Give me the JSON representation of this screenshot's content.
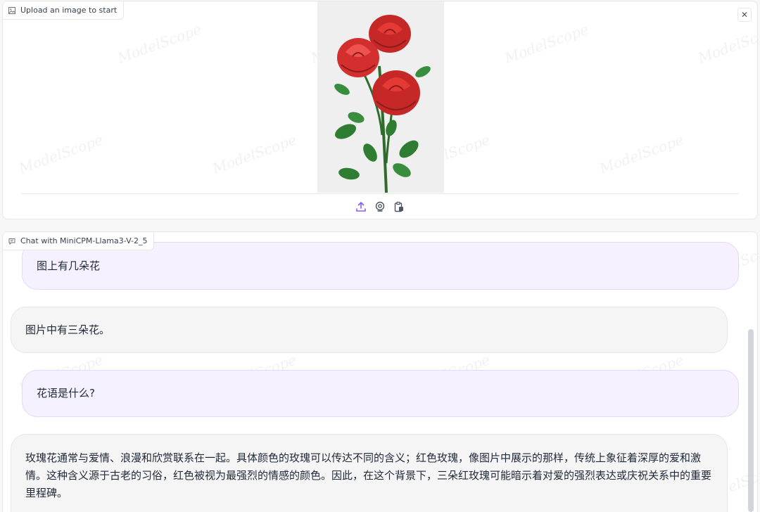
{
  "upload": {
    "label": "Upload an image to start",
    "close_symbol": "✕",
    "sources": [
      {
        "name": "upload-icon",
        "color": "#8b5cf6"
      },
      {
        "name": "webcam-icon",
        "color": "#4b5563"
      },
      {
        "name": "clipboard-icon",
        "color": "#4b5563"
      }
    ]
  },
  "chat": {
    "label": "Chat with MiniCPM-Llama3-V-2_5",
    "messages": [
      {
        "role": "user",
        "text": "图上有几朵花"
      },
      {
        "role": "bot",
        "text": "图片中有三朵花。"
      },
      {
        "role": "user",
        "text": "花语是什么?"
      },
      {
        "role": "bot",
        "text": "玫瑰花通常与爱情、浪漫和欣赏联系在一起。具体颜色的玫瑰可以传达不同的含义；红色玫瑰，像图片中展示的那样，传统上象征着深厚的爱和激情。这种含义源于古老的习俗，红色被视为最强烈的情感的颜色。因此，在这个背景下，三朵红玫瑰可能暗示着对爱的强烈表达或庆祝关系中的重要里程碑。"
      }
    ]
  },
  "colors": {
    "accent": "#8b5cf6",
    "user_bubble": "#f6f1ff",
    "bot_bubble": "#f5f5f6"
  }
}
